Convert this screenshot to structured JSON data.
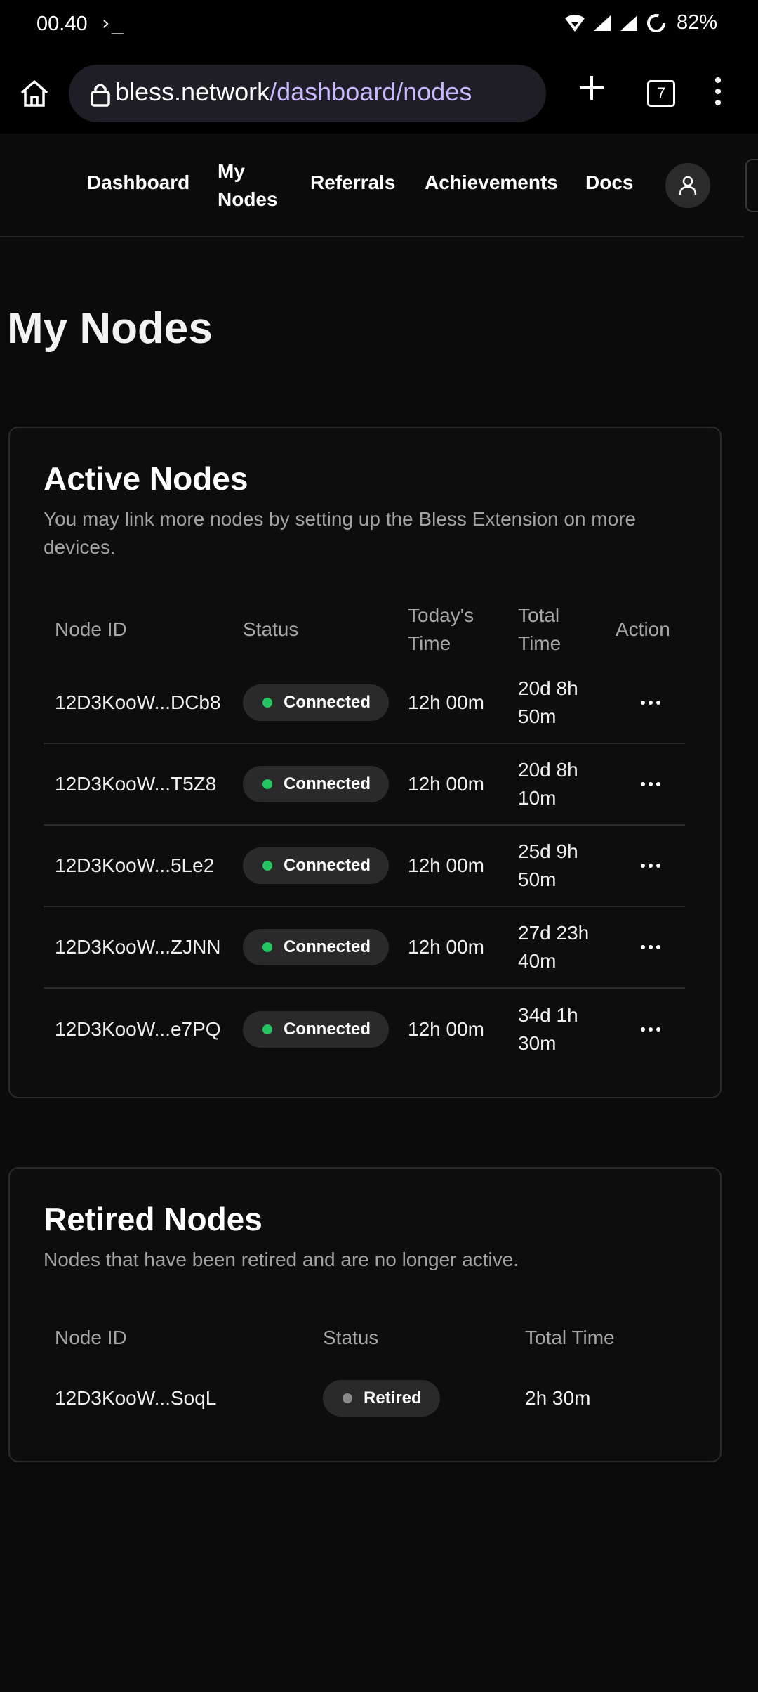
{
  "status_bar": {
    "time": "00.40",
    "terminal_glyph": "›_",
    "battery": "82%"
  },
  "browser": {
    "url_host": "bless.network",
    "url_path": "/dashboard/nodes",
    "tab_count": "7"
  },
  "nav": {
    "items": [
      {
        "label": "Dashboard"
      },
      {
        "label": "My Nodes"
      },
      {
        "label": "Referrals"
      },
      {
        "label": "Achievements"
      },
      {
        "label": "Docs"
      }
    ]
  },
  "page": {
    "title": "My Nodes"
  },
  "active_nodes": {
    "title": "Active Nodes",
    "description": "You may link more nodes by setting up the Bless Extension on more devices.",
    "columns": [
      "Node ID",
      "Status",
      "Today's Time",
      "Total Time",
      "Action"
    ],
    "rows": [
      {
        "node_id": "12D3KooW...DCb8",
        "status": "Connected",
        "today": "12h 00m",
        "total": "20d 8h 50m"
      },
      {
        "node_id": "12D3KooW...T5Z8",
        "status": "Connected",
        "today": "12h 00m",
        "total": "20d 8h 10m"
      },
      {
        "node_id": "12D3KooW...5Le2",
        "status": "Connected",
        "today": "12h 00m",
        "total": "25d 9h 50m"
      },
      {
        "node_id": "12D3KooW...ZJNN",
        "status": "Connected",
        "today": "12h 00m",
        "total": "27d 23h 40m"
      },
      {
        "node_id": "12D3KooW...e7PQ",
        "status": "Connected",
        "today": "12h 00m",
        "total": "34d 1h 30m"
      }
    ]
  },
  "retired_nodes": {
    "title": "Retired Nodes",
    "description": "Nodes that have been retired and are no longer active.",
    "columns": [
      "Node ID",
      "Status",
      "Total Time"
    ],
    "rows": [
      {
        "node_id": "12D3KooW...SoqL",
        "status": "Retired",
        "total": "2h 30m"
      }
    ]
  },
  "colors": {
    "connected": "#22c55e",
    "retired": "#8a8a8a",
    "accent_path": "#c9b7ff"
  }
}
